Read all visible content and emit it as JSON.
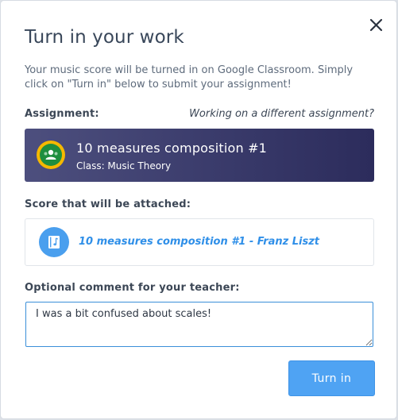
{
  "dialog": {
    "title": "Turn in your work",
    "description": "Your music score will be turned in on Google Classroom. Simply click on \"Turn in\" below to submit your assignment!",
    "close_icon": "close-icon"
  },
  "assignment": {
    "label": "Assignment:",
    "alternate_link": "Working on a different assignment?",
    "title": "10 measures composition #1",
    "class_label": "Class: Music Theory",
    "icon": "google-classroom-icon"
  },
  "score": {
    "label": "Score that will be attached:",
    "title": "10 measures composition #1 - Franz Liszt",
    "icon": "music-score-icon"
  },
  "comment": {
    "label": "Optional comment for your teacher:",
    "value": "I was a bit confused about scales!"
  },
  "actions": {
    "turn_in_label": "Turn in"
  },
  "colors": {
    "accent": "#4fa3f3",
    "link": "#2f8fe8",
    "card_gradient_start": "#4d4f7e",
    "card_gradient_end": "#2c2c5c",
    "classroom_ring": "#f5b800",
    "classroom_green": "#1e8e3e"
  }
}
